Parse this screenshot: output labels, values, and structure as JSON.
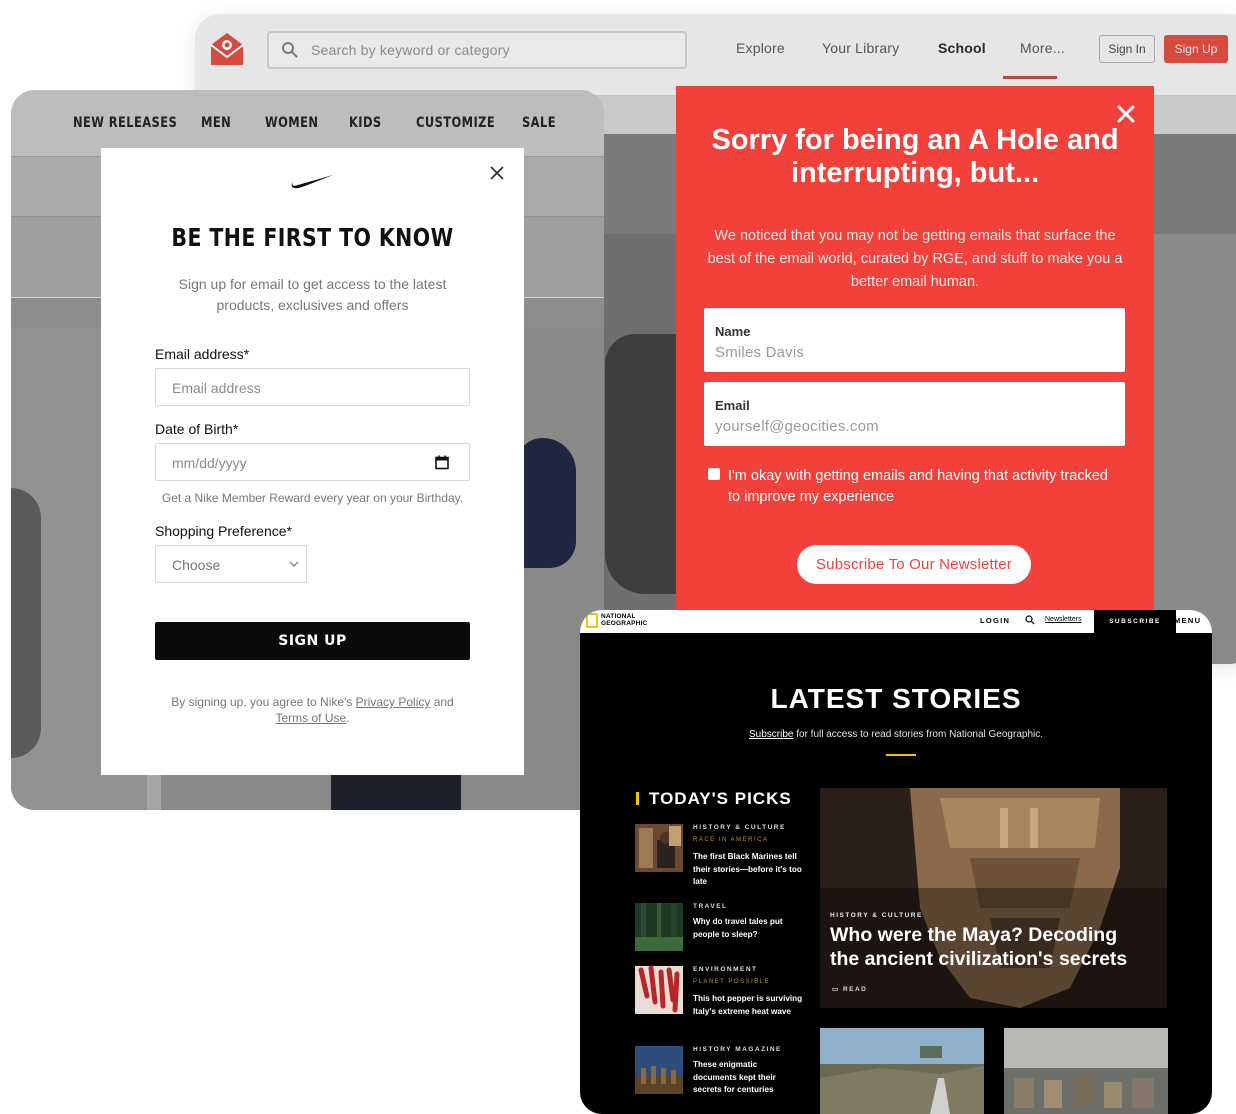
{
  "email_site": {
    "search_placeholder": "Search by keyword or category",
    "nav": [
      "Explore",
      "Your Library",
      "School",
      "More..."
    ],
    "sign_in": "Sign In",
    "sign_up": "Sign Up",
    "colors": {
      "brand": "#d64a40"
    }
  },
  "red_modal": {
    "title": "Sorry for being an A Hole and interrupting, but...",
    "description": "We noticed that you may not be getting emails that surface the best of the email world, curated by RGE, and stuff to make you a better email human.",
    "name_label": "Name",
    "name_placeholder": "Smiles Davis",
    "email_label": "Email",
    "email_placeholder": "yourself@geocities.com",
    "consent": "I'm okay with getting emails and having that activity tracked to improve my experience",
    "subscribe_button": "Subscribe To Our Newsletter",
    "colors": {
      "background": "#f2403a"
    }
  },
  "nike": {
    "nav": [
      "NEW RELEASES",
      "MEN",
      "WOMEN",
      "KIDS",
      "CUSTOMIZE",
      "SALE"
    ],
    "modal": {
      "heading": "BE THE FIRST TO KNOW",
      "subheading": "Sign up for email to get access to the latest products, exclusives and offers",
      "email_label": "Email address*",
      "email_placeholder": "Email address",
      "dob_label": "Date of Birth*",
      "dob_placeholder": "mm/dd/yyyy",
      "dob_hint": "Get a Nike Member Reward every year on your Birthday.",
      "pref_label": "Shopping Preference*",
      "pref_value": "Choose",
      "signup_button": "SIGN UP",
      "legal_prefix": "By signing up, you agree to Nike's ",
      "privacy_link": "Privacy Policy",
      "legal_and": " and",
      "terms_link": "Terms of Use",
      "legal_suffix": "."
    }
  },
  "natgeo": {
    "logo_line1": "NATIONAL",
    "logo_line2": "GEOGRAPHIC",
    "login": "LOGIN",
    "newsletters": "Newsletters",
    "subscribe": "SUBSCRIBE",
    "menu": "MENU",
    "heading": "LATEST STORIES",
    "tagline_link": "Subscribe",
    "tagline_rest": " for full access to read stories from National Geographic.",
    "picks_title": "TODAY'S PICKS",
    "picks": [
      {
        "category": "HISTORY & CULTURE",
        "subcategory": "RACE IN AMERICA",
        "title": "The first Black Marines tell their stories—before it's too late"
      },
      {
        "category": "TRAVEL",
        "subcategory": "",
        "title": "Why do travel tales put people to sleep?"
      },
      {
        "category": "ENVIRONMENT",
        "subcategory": "PLANET POSSIBLE",
        "title": "This hot pepper is surviving Italy's extreme heat wave"
      },
      {
        "category": "HISTORY MAGAZINE",
        "subcategory": "",
        "title": "These enigmatic documents kept their secrets for centuries"
      }
    ],
    "hero": {
      "category": "HISTORY & CULTURE",
      "title": "Who were the Maya? Decoding the ancient civilization's secrets",
      "read": "READ"
    },
    "colors": {
      "accent": "#f5c400"
    }
  }
}
